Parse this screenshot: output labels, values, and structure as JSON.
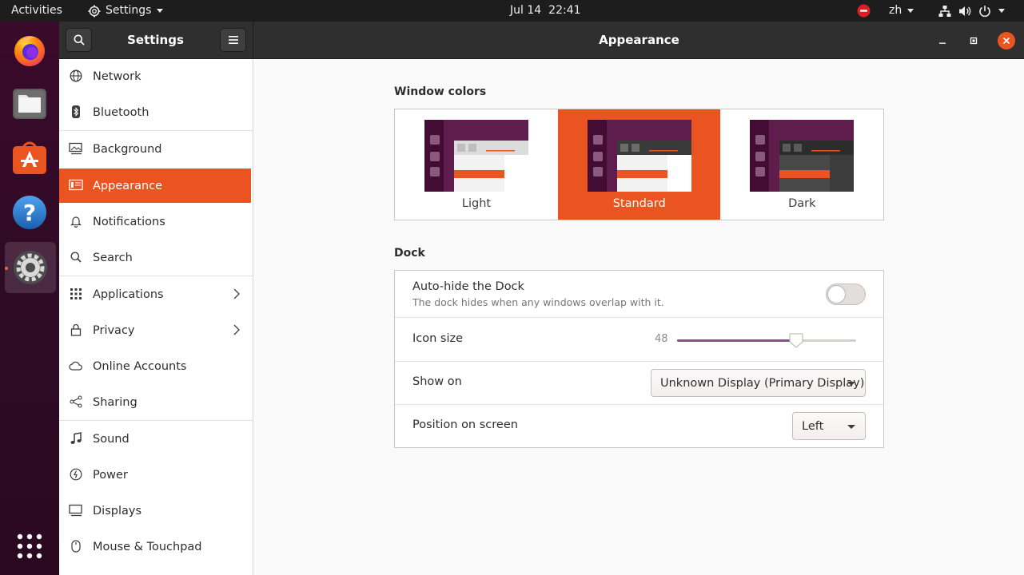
{
  "topbar": {
    "activities": "Activities",
    "app_menu": "Settings",
    "date": "Jul 14",
    "time": "22:41",
    "language": "zh"
  },
  "window": {
    "sidebar_title": "Settings",
    "page_title": "Appearance"
  },
  "sidebar": {
    "items": [
      {
        "label": "Network"
      },
      {
        "label": "Bluetooth"
      },
      {
        "label": "Background"
      },
      {
        "label": "Appearance"
      },
      {
        "label": "Notifications"
      },
      {
        "label": "Search"
      },
      {
        "label": "Applications"
      },
      {
        "label": "Privacy"
      },
      {
        "label": "Online Accounts"
      },
      {
        "label": "Sharing"
      },
      {
        "label": "Sound"
      },
      {
        "label": "Power"
      },
      {
        "label": "Displays"
      },
      {
        "label": "Mouse & Touchpad"
      }
    ],
    "selected": "Appearance"
  },
  "window_colors": {
    "title": "Window colors",
    "options": [
      {
        "label": "Light"
      },
      {
        "label": "Standard"
      },
      {
        "label": "Dark"
      }
    ],
    "selected": "Standard"
  },
  "dock": {
    "title": "Dock",
    "autohide": {
      "label": "Auto-hide the Dock",
      "description": "The dock hides when any windows overlap with it.",
      "enabled": false
    },
    "icon_size": {
      "label": "Icon size",
      "value": "48",
      "min": 16,
      "max": 64
    },
    "show_on": {
      "label": "Show on",
      "value": "Unknown Display (Primary Display)"
    },
    "position": {
      "label": "Position on screen",
      "value": "Left"
    }
  },
  "colors": {
    "accent": "#e95420",
    "slider": "#924d8b",
    "aubergine": "#2c001e"
  }
}
